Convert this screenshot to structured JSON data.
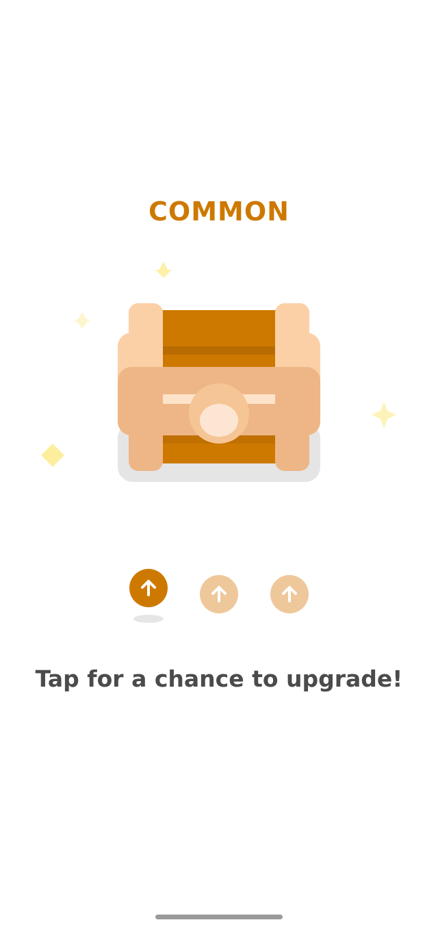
{
  "reward": {
    "rarity_label": "COMMON",
    "icon": "treasure-chest-icon",
    "sparkle_icon": "sparkle-icon"
  },
  "upgrade": {
    "buttons": [
      {
        "icon": "arrow-up-icon",
        "state": "active"
      },
      {
        "icon": "arrow-up-icon",
        "state": "inactive"
      },
      {
        "icon": "arrow-up-icon",
        "state": "inactive"
      }
    ],
    "hint": "Tap for a chance to upgrade!"
  },
  "colors": {
    "accent": "#cd7900",
    "accent_light": "#eec89b",
    "chest_wood": "#cd7900",
    "chest_wood_dark": "#b86b00",
    "chest_frame": "#fcd0a6",
    "chest_band": "#eeb687",
    "sparkle": "#fdee9e",
    "text": "#4b4b4b"
  }
}
